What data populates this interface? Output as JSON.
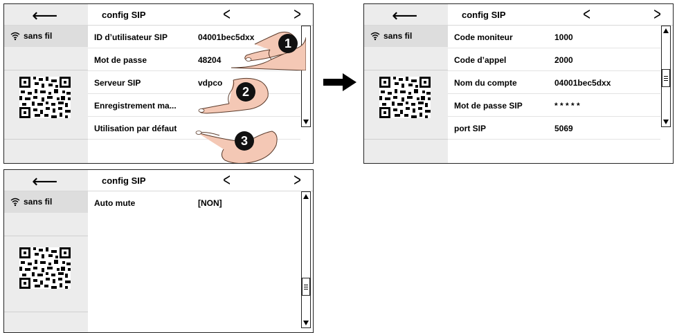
{
  "panels": [
    {
      "back_icon": "arrow-left-icon",
      "title": "config SIP",
      "prev_icon": "chevron-left-icon",
      "next_icon": "chevron-right-icon",
      "sidebar": {
        "wifi_label": "sans fil"
      },
      "rows": [
        {
          "label": "ID d’utilisateur SIP",
          "value": "04001bec5dxx"
        },
        {
          "label": "Mot de passe",
          "value": "48204"
        },
        {
          "label": "Serveur SIP",
          "value": "vdpco"
        },
        {
          "label": "Enregistrement ma...",
          "value": ""
        },
        {
          "label": "Utilisation par défaut",
          "value": ""
        }
      ],
      "callouts": [
        "1",
        "2",
        "3"
      ]
    },
    {
      "back_icon": "arrow-left-icon",
      "title": "config SIP",
      "prev_icon": "chevron-left-icon",
      "next_icon": "chevron-right-icon",
      "sidebar": {
        "wifi_label": "sans fil"
      },
      "rows": [
        {
          "label": "Code moniteur",
          "value": "1000"
        },
        {
          "label": "Code d’appel",
          "value": "2000"
        },
        {
          "label": "Nom du compte",
          "value": "04001bec5dxx"
        },
        {
          "label": "Mot de passe SIP",
          "value": "* * * * *"
        },
        {
          "label": "port SIP",
          "value": "5069"
        }
      ]
    },
    {
      "back_icon": "arrow-left-icon",
      "title": "config SIP",
      "prev_icon": "chevron-left-icon",
      "next_icon": "chevron-right-icon",
      "sidebar": {
        "wifi_label": "sans fil"
      },
      "rows": [
        {
          "label": "Auto mute",
          "value": "[NON]"
        }
      ]
    }
  ],
  "arrow_icon": "arrow-right-icon"
}
